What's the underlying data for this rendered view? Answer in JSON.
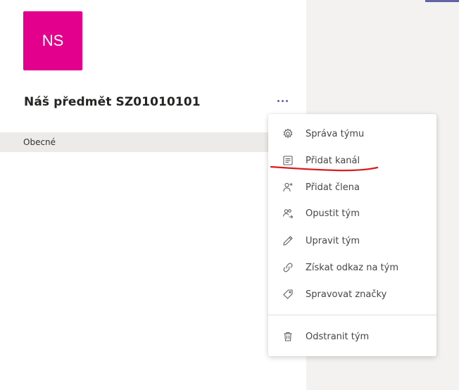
{
  "team": {
    "initials": "NS",
    "avatar_color": "#e3008c",
    "name": "Náš předmět SZ01010101",
    "more_icon": "more-options-icon"
  },
  "channels": [
    {
      "label": "Obecné"
    }
  ],
  "menu": {
    "items": [
      {
        "label": "Správa týmu",
        "icon": "gear-icon"
      },
      {
        "label": "Přidat kanál",
        "icon": "add-channel-icon"
      },
      {
        "label": "Přidat člena",
        "icon": "add-person-icon"
      },
      {
        "label": "Opustit tým",
        "icon": "leave-icon"
      },
      {
        "label": "Upravit tým",
        "icon": "pencil-icon"
      },
      {
        "label": "Získat odkaz na tým",
        "icon": "link-icon"
      },
      {
        "label": "Spravovat značky",
        "icon": "tag-icon"
      },
      {
        "label": "Odstranit tým",
        "icon": "trash-icon"
      }
    ]
  },
  "annotation": {
    "underline_color": "#d91e1e"
  },
  "colors": {
    "accent": "#6264a7",
    "right_pane": "#f3f2f1",
    "selected_row": "#edebe9"
  }
}
